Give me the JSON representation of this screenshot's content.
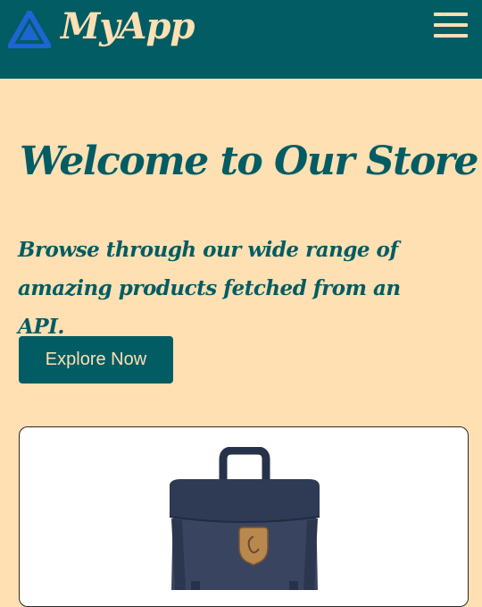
{
  "navbar": {
    "brand": "MyApp",
    "logo_icon": "logo-icon",
    "menu_icon": "hamburger-menu-icon"
  },
  "hero": {
    "title": "Welcome to Our Store",
    "subtitle": "Browse through our wide range of amazing products fetched from an API.",
    "cta_label": "Explore Now"
  },
  "products": [
    {
      "image_icon": "backpack-product-image"
    }
  ],
  "colors": {
    "primary": "#015C63",
    "background": "#FEE0B3",
    "logo": "#1E64D2"
  }
}
